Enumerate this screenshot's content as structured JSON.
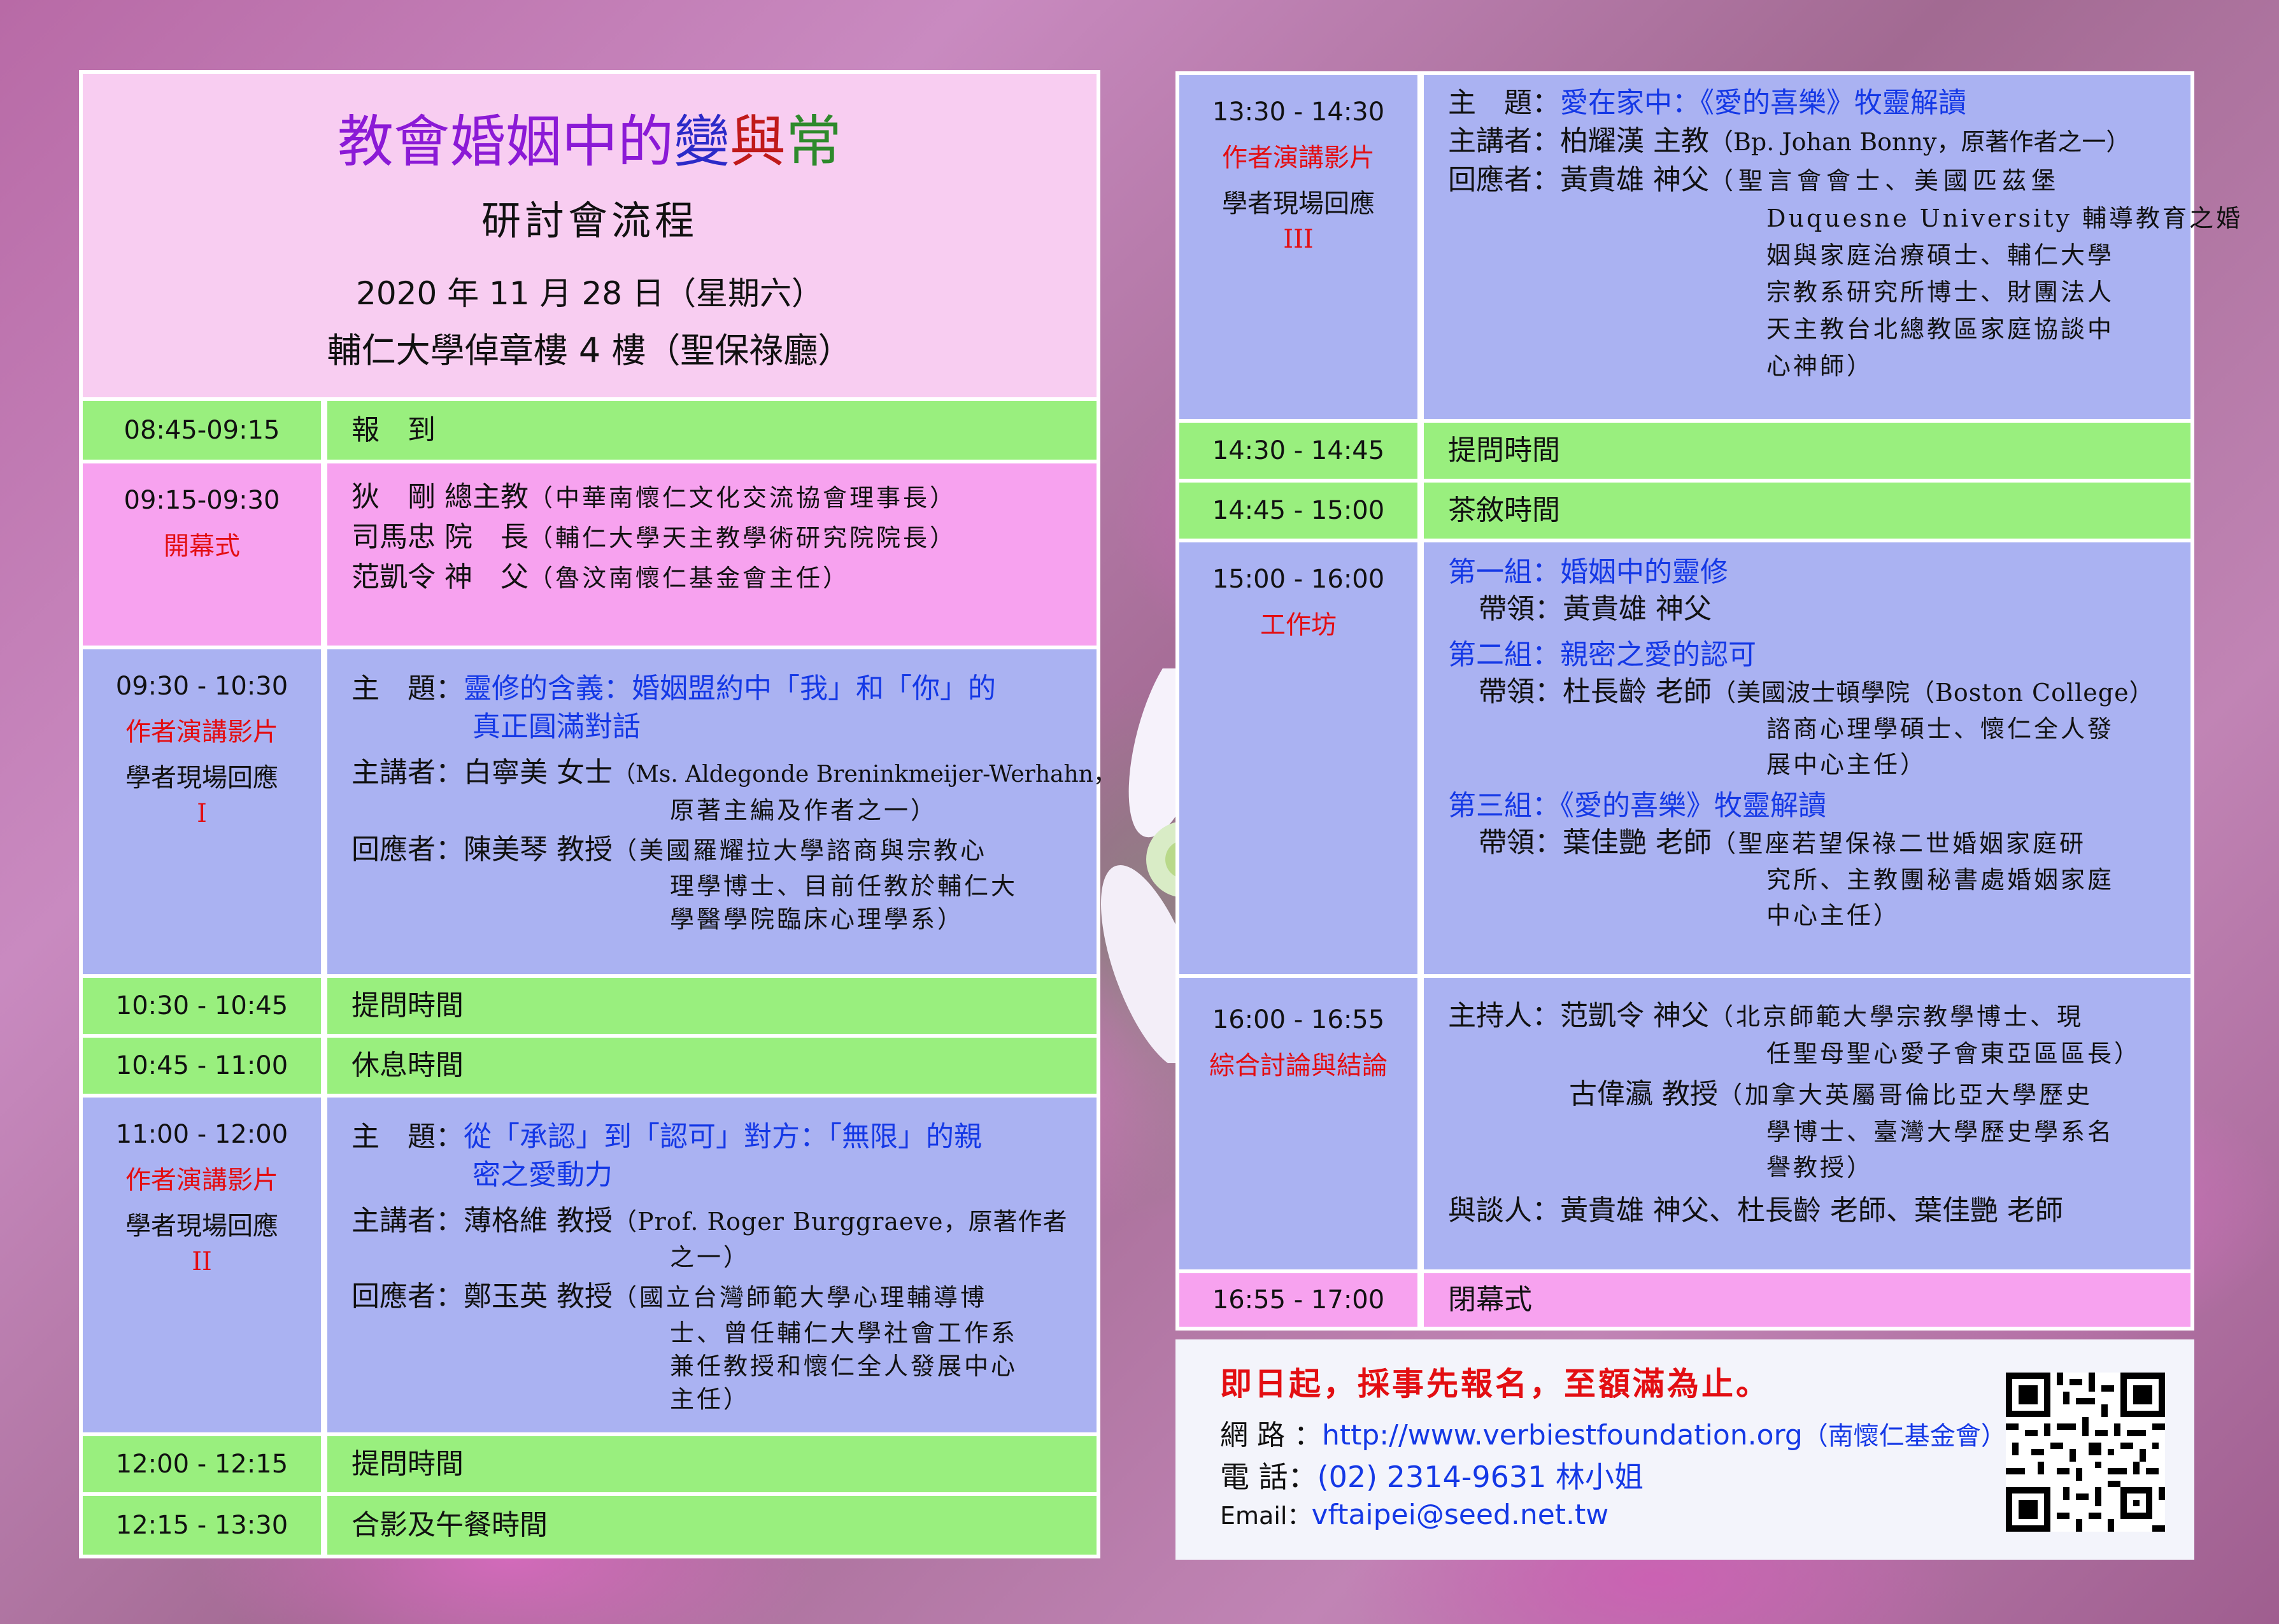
{
  "title": {
    "part1": "教會婚姻中的",
    "bian": "變",
    "yu": "與",
    "chang": "常",
    "subtitle": "研討會流程",
    "date": "2020 年 11 月 28 日（星期六）",
    "venue": "輔仁大學倬章樓 4 樓（聖保祿廳）"
  },
  "left": [
    {
      "time": "08:45-09:15",
      "content": "報　到"
    },
    {
      "time": "09:15-09:30",
      "label": "開幕式",
      "lines": [
        {
          "name": "狄　剛 總主教",
          "note": "（中華南懷仁文化交流協會理事長）"
        },
        {
          "name": "司馬忠 院　長",
          "note": "（輔仁大學天主教學術研究院院長）"
        },
        {
          "name": "范凱令 神　父",
          "note": "（魯汶南懷仁基金會主任）"
        }
      ]
    },
    {
      "time": "09:30 - 10:30",
      "label": "作者演講影片",
      "label2": "學者現場回應",
      "roman": "I",
      "topic_label": "主　題：",
      "topic": "靈修的含義：婚姻盟約中「我」和「你」的",
      "topic2": "真正圓滿對話",
      "speaker_label": "主講者：",
      "speaker": "白寧美 女士",
      "speaker_note": "（Ms. Aldegonde Breninkmeijer-Werhahn，",
      "speaker_note2": "原著主編及作者之一）",
      "resp_label": "回應者：",
      "resp": "陳美琴 教授",
      "resp_note": "（美國羅耀拉大學諮商與宗教心",
      "resp_note2": "理學博士、目前任教於輔仁大",
      "resp_note3": "學醫學院臨床心理學系）"
    },
    {
      "time": "10:30 - 10:45",
      "content": "提問時間"
    },
    {
      "time": "10:45 - 11:00",
      "content": "休息時間"
    },
    {
      "time": "11:00 - 12:00",
      "label": "作者演講影片",
      "label2": "學者現場回應",
      "roman": "II",
      "topic_label": "主　題：",
      "topic": "從「承認」到「認可」對方：「無限」的親",
      "topic2": "密之愛動力",
      "speaker_label": "主講者：",
      "speaker": "薄格維 教授",
      "speaker_note": "（Prof. Roger Burggraeve，原著作者",
      "speaker_note2": "之一）",
      "resp_label": "回應者：",
      "resp": "鄭玉英 教授",
      "resp_note": "（國立台灣師範大學心理輔導博",
      "resp_note2": "士、曾任輔仁大學社會工作系",
      "resp_note3": "兼任教授和懷仁全人發展中心",
      "resp_note4": "主任）"
    },
    {
      "time": "12:00 - 12:15",
      "content": "提問時間"
    },
    {
      "time": "12:15 - 13:30",
      "content": "合影及午餐時間"
    }
  ],
  "right": [
    {
      "time": "13:30 - 14:30",
      "label": "作者演講影片",
      "label2": "學者現場回應",
      "roman": "III",
      "topic_label": "主　題：",
      "topic": "愛在家中：《愛的喜樂》牧靈解讀",
      "speaker_label": "主講者：",
      "speaker": "柏耀漢 主教",
      "speaker_note": "（Bp. Johan Bonny，原著作者之一）",
      "resp_label": "回應者：",
      "resp": "黃貴雄 神父",
      "resp_note": "（聖言會會士、美國匹茲堡",
      "resp_more": [
        "Duquesne University 輔導教育之婚",
        "姻與家庭治療碩士、輔仁大學",
        "宗教系研究所博士、財團法人",
        "天主教台北總教區家庭協談中",
        "心神師）"
      ]
    },
    {
      "time": "14:30 - 14:45",
      "content": "提問時間"
    },
    {
      "time": "14:45 - 15:00",
      "content": "茶敘時間"
    },
    {
      "time": "15:00 - 16:00",
      "label": "工作坊",
      "groups": [
        {
          "title": "第一組：婚姻中的靈修",
          "lead_label": "帶領：",
          "lead": "黃貴雄 神父",
          "notes": []
        },
        {
          "title": "第二組：親密之愛的認可",
          "lead_label": "帶領：",
          "lead": "杜長齡 老師",
          "notes": [
            "（美國波士頓學院（Boston College）",
            "諮商心理學碩士、懷仁全人發",
            "展中心主任）"
          ]
        },
        {
          "title": "第三組：《愛的喜樂》牧靈解讀",
          "lead_label": "帶領：",
          "lead": "葉佳艷 老師",
          "notes": [
            "（聖座若望保祿二世婚姻家庭研",
            "究所、主教團秘書處婚姻家庭",
            "中心主任）"
          ]
        }
      ]
    },
    {
      "time": "16:00 - 16:55",
      "label": "綜合討論與結論",
      "host_label": "主持人：",
      "host": "范凱令 神父",
      "host_note": "（北京師範大學宗教學博士、現",
      "host_note2": "任聖母聖心愛子會東亞區區長）",
      "host2": "古偉瀛 教授",
      "host2_note": "（加拿大英屬哥倫比亞大學歷史",
      "host2_note2": "學博士、臺灣大學歷史學系名",
      "host2_note3": "譽教授）",
      "talk_label": "與談人：",
      "talk": "黃貴雄 神父、杜長齡 老師、葉佳艷 老師"
    },
    {
      "time": "16:55 - 17:00",
      "content": "閉幕式"
    }
  ],
  "footer": {
    "headline": "即日起，採事先報名，至額滿為止。",
    "web_label": "網 路 ：",
    "web": "http://www.verbiestfoundation.org",
    "web_note": "（南懷仁基金會）",
    "tel_label": "電 話：",
    "tel": "(02) 2314-9631 林小姐",
    "email_label": "Email：",
    "email": "vftaipei@seed.net.tw"
  },
  "colors": {
    "green": "#99ef7e",
    "pink": "#f7a2ef",
    "blue": "#aab2f2",
    "title_bg": "#f8cdf1",
    "red": "#e30e12",
    "blue_text": "#1438e6"
  },
  "icons": {
    "qr": "qr-code-icon"
  }
}
